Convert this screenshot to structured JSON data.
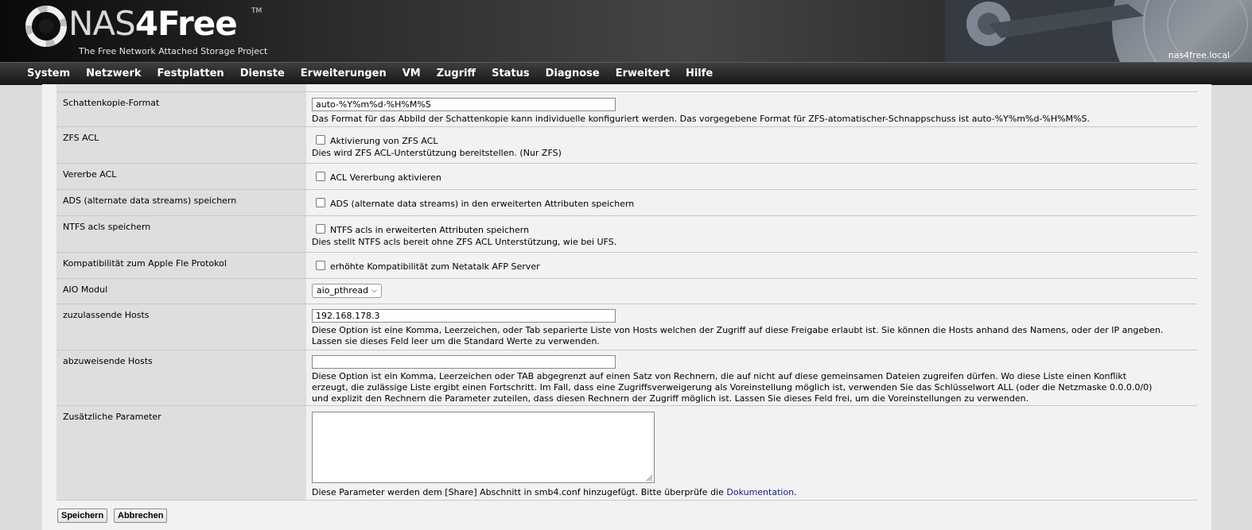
{
  "header": {
    "logo_main": "NAS",
    "logo_four": "4Free",
    "logo_tm": "TM",
    "subtitle": "The Free Network Attached Storage Project",
    "hostname": "nas4free.local"
  },
  "nav": [
    "System",
    "Netzwerk",
    "Festplatten",
    "Dienste",
    "Erweiterungen",
    "VM",
    "Zugriff",
    "Status",
    "Diagnose",
    "Erweitert",
    "Hilfe"
  ],
  "rows": {
    "shadow_format": {
      "label": "Schattenkopie-Format",
      "value": "auto-%Y%m%d-%H%M%S",
      "desc": "Das Format für das Abbild der Schattenkopie kann individuelle konfiguriert werden. Das vorgegebene Format für ZFS-atomatischer-Schnappschuss ist auto-%Y%m%d-%H%M%S."
    },
    "zfs_acl": {
      "label": "ZFS ACL",
      "check_label": "Aktivierung von ZFS ACL",
      "desc": "Dies wird ZFS ACL-Unterstützung bereitstellen. (Nur ZFS)"
    },
    "inherit_acl": {
      "label": "Vererbe ACL",
      "check_label": "ACL Vererbung aktivieren"
    },
    "ads": {
      "label": "ADS (alternate data streams) speichern",
      "check_label": "ADS (alternate data streams) in den erweiterten Attributen speichern"
    },
    "ntfs": {
      "label": "NTFS acls speichern",
      "check_label": "NTFS acls in erweiterten Attributen speichern",
      "desc": "Dies stellt NTFS acls bereit ohne ZFS ACL Unterstützung, wie bei UFS."
    },
    "afp": {
      "label": "Kompatibilität zum Apple Fle Protokol",
      "check_label": "erhöhte Kompatibilität zum Netatalk AFP Server"
    },
    "aio": {
      "label": "AIO Modul",
      "selected": "aio_pthread"
    },
    "hosts_allow": {
      "label": "zuzulassende Hosts",
      "value": "192.168.178.3",
      "desc": "Diese Option ist eine Komma, Leerzeichen, oder Tab separierte Liste von Hosts welchen der Zugriff auf diese Freigabe erlaubt ist. Sie können die Hosts anhand des Namens, oder der IP angeben. Lassen sie dieses Feld leer um die Standard Werte zu verwenden."
    },
    "hosts_deny": {
      "label": "abzuweisende Hosts",
      "value": "",
      "desc": "Diese Option ist ein Komma, Leerzeichen oder TAB abgegrenzt auf einen Satz von Rechnern, die auf nicht auf diese gemeinsamen Dateien zugreifen dürfen. Wo diese Liste einen Konflikt erzeugt, die zulässige Liste ergibt einen Fortschritt. Im Fall, dass eine Zugriffsverweigerung als Voreinstellung möglich ist, verwenden Sie das Schlüsselwort ALL (oder die Netzmaske 0.0.0.0/0) und explizit den Rechnern die Parameter zuteilen, dass diesen Rechnern der Zugriff möglich ist. Lassen Sie dieses Feld frei, um die Voreinstellungen zu verwenden."
    },
    "aux": {
      "label": "Zusätzliche Parameter",
      "value": "",
      "desc_prefix": "Diese Parameter werden dem [Share] Abschnitt in smb4.conf hinzugefügt. Bitte überprüfe die ",
      "desc_link": "Dokumentation",
      "desc_suffix": "."
    }
  },
  "buttons": {
    "save": "Speichern",
    "cancel": "Abbrechen"
  }
}
